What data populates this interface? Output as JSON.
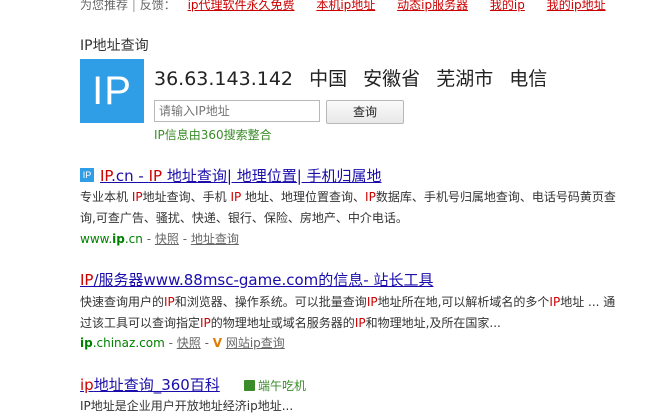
{
  "recommend_bar": {
    "label": "为您推荐",
    "divider": "|",
    "feedback": "反馈：",
    "links": [
      "ip代理软件永久免费",
      "本机ip地址",
      "动态ip服务器",
      "我的ip",
      "我的ip地址"
    ]
  },
  "ip_box": {
    "title": "IP地址查询",
    "logo_text": "IP",
    "ip": "36.63.143.142",
    "country": "中国",
    "province": "安徽省",
    "city": "芜湖市",
    "isp": "电信",
    "input_placeholder": "请输入IP地址",
    "query_button": "查询",
    "source": "IP信息由360搜索整合"
  },
  "results": [
    {
      "icon_text": "IP",
      "title_parts": [
        "IP",
        ".cn - ",
        "IP",
        " 地址查询| 地理位置| 手机归属地"
      ],
      "desc_parts": [
        "专业本机 ",
        "IP",
        "地址查询、手机 ",
        "IP",
        " 地址、地理位置查询、",
        "IP",
        "数据库、手机号归属地查询、电话号码黄页查询,可查广告、骚扰、快递、银行、保险、房地产、中介电话。"
      ],
      "url_prefix": "www.",
      "url_bold": "ip",
      "url_suffix": ".cn",
      "sep": " - ",
      "snapshot": "快照",
      "extra": "地址查询"
    },
    {
      "title_parts": [
        "IP",
        "/服务器www.88msc-game.com的信息- 站长工具"
      ],
      "desc_parts": [
        "快速查询用户的",
        "IP",
        "和浏览器、操作系统。可以批量查询",
        "IP",
        "地址所在地,可以解析域名的多个",
        "IP",
        "地址 ... 通过该工具可以查询指定",
        "IP",
        "的物理地址或域名服务器的",
        "IP",
        "和物理地址,及所在国家..."
      ],
      "url_bold": "ip",
      "url_suffix": ".chinaz.com",
      "sep": " - ",
      "snapshot": "快照",
      "v_mark": "V",
      "extra": "网站ip查询"
    },
    {
      "title_parts": [
        "ip",
        "地址查询_360百科"
      ],
      "badge": "端午吃机",
      "desc": "IP地址是企业用户开放地址经济ip地址..."
    }
  ]
}
